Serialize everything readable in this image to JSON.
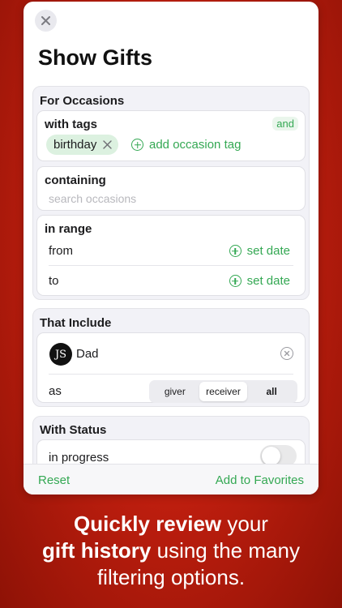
{
  "sheet": {
    "title": "Show Gifts",
    "close_icon": "close-icon",
    "occasions": {
      "heading": "For Occasions",
      "tags": {
        "label": "with tags",
        "mode": "and",
        "chips": [
          "birthday"
        ],
        "add_label": "add occasion tag"
      },
      "containing": {
        "label": "containing",
        "placeholder": "search occasions"
      },
      "range": {
        "label": "in range",
        "from_label": "from",
        "from_action": "set date",
        "to_label": "to",
        "to_action": "set date"
      }
    },
    "include": {
      "heading": "That Include",
      "person": {
        "initials": "JS",
        "name": "Dad"
      },
      "as_label": "as",
      "roles": [
        "giver",
        "receiver",
        "all"
      ],
      "selected_role": "receiver"
    },
    "status": {
      "heading": "With Status",
      "item_label": "in progress",
      "item_on": false
    },
    "footer": {
      "reset_label": "Reset",
      "favorites_label": "Add to Favorites"
    }
  },
  "caption": {
    "line1_bold": "Quickly review",
    "line1_rest": " your",
    "line2_bold": "gift history",
    "line2_rest": " using the many",
    "line3": "filtering options."
  },
  "colors": {
    "accent": "#34a853",
    "background": "#c21f0f"
  }
}
